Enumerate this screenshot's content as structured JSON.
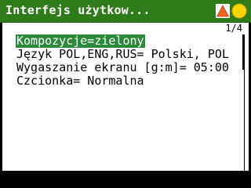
{
  "window": {
    "title": "Interfejs użytkow...",
    "page_indicator": "1/4"
  },
  "status_icons": [
    {
      "name": "warning-triangle-icon",
      "color": "#f26522"
    },
    {
      "name": "yellow-circle-icon",
      "color": "#ffd500"
    }
  ],
  "colors": {
    "title_bar": "#2f7a1a",
    "selection": "#2a8a3a",
    "panel": "#ffffff",
    "background": "#000000"
  },
  "menu": {
    "items": [
      {
        "label": "Kompozycje=zielony",
        "selected": true
      },
      {
        "label": "Język POL,ENG,RUS= Polski, POL",
        "selected": false
      },
      {
        "label": "Wygaszanie ekranu [g:m]= 05:00",
        "selected": false
      },
      {
        "label": "Czcionka= Normalna",
        "selected": false
      }
    ]
  }
}
